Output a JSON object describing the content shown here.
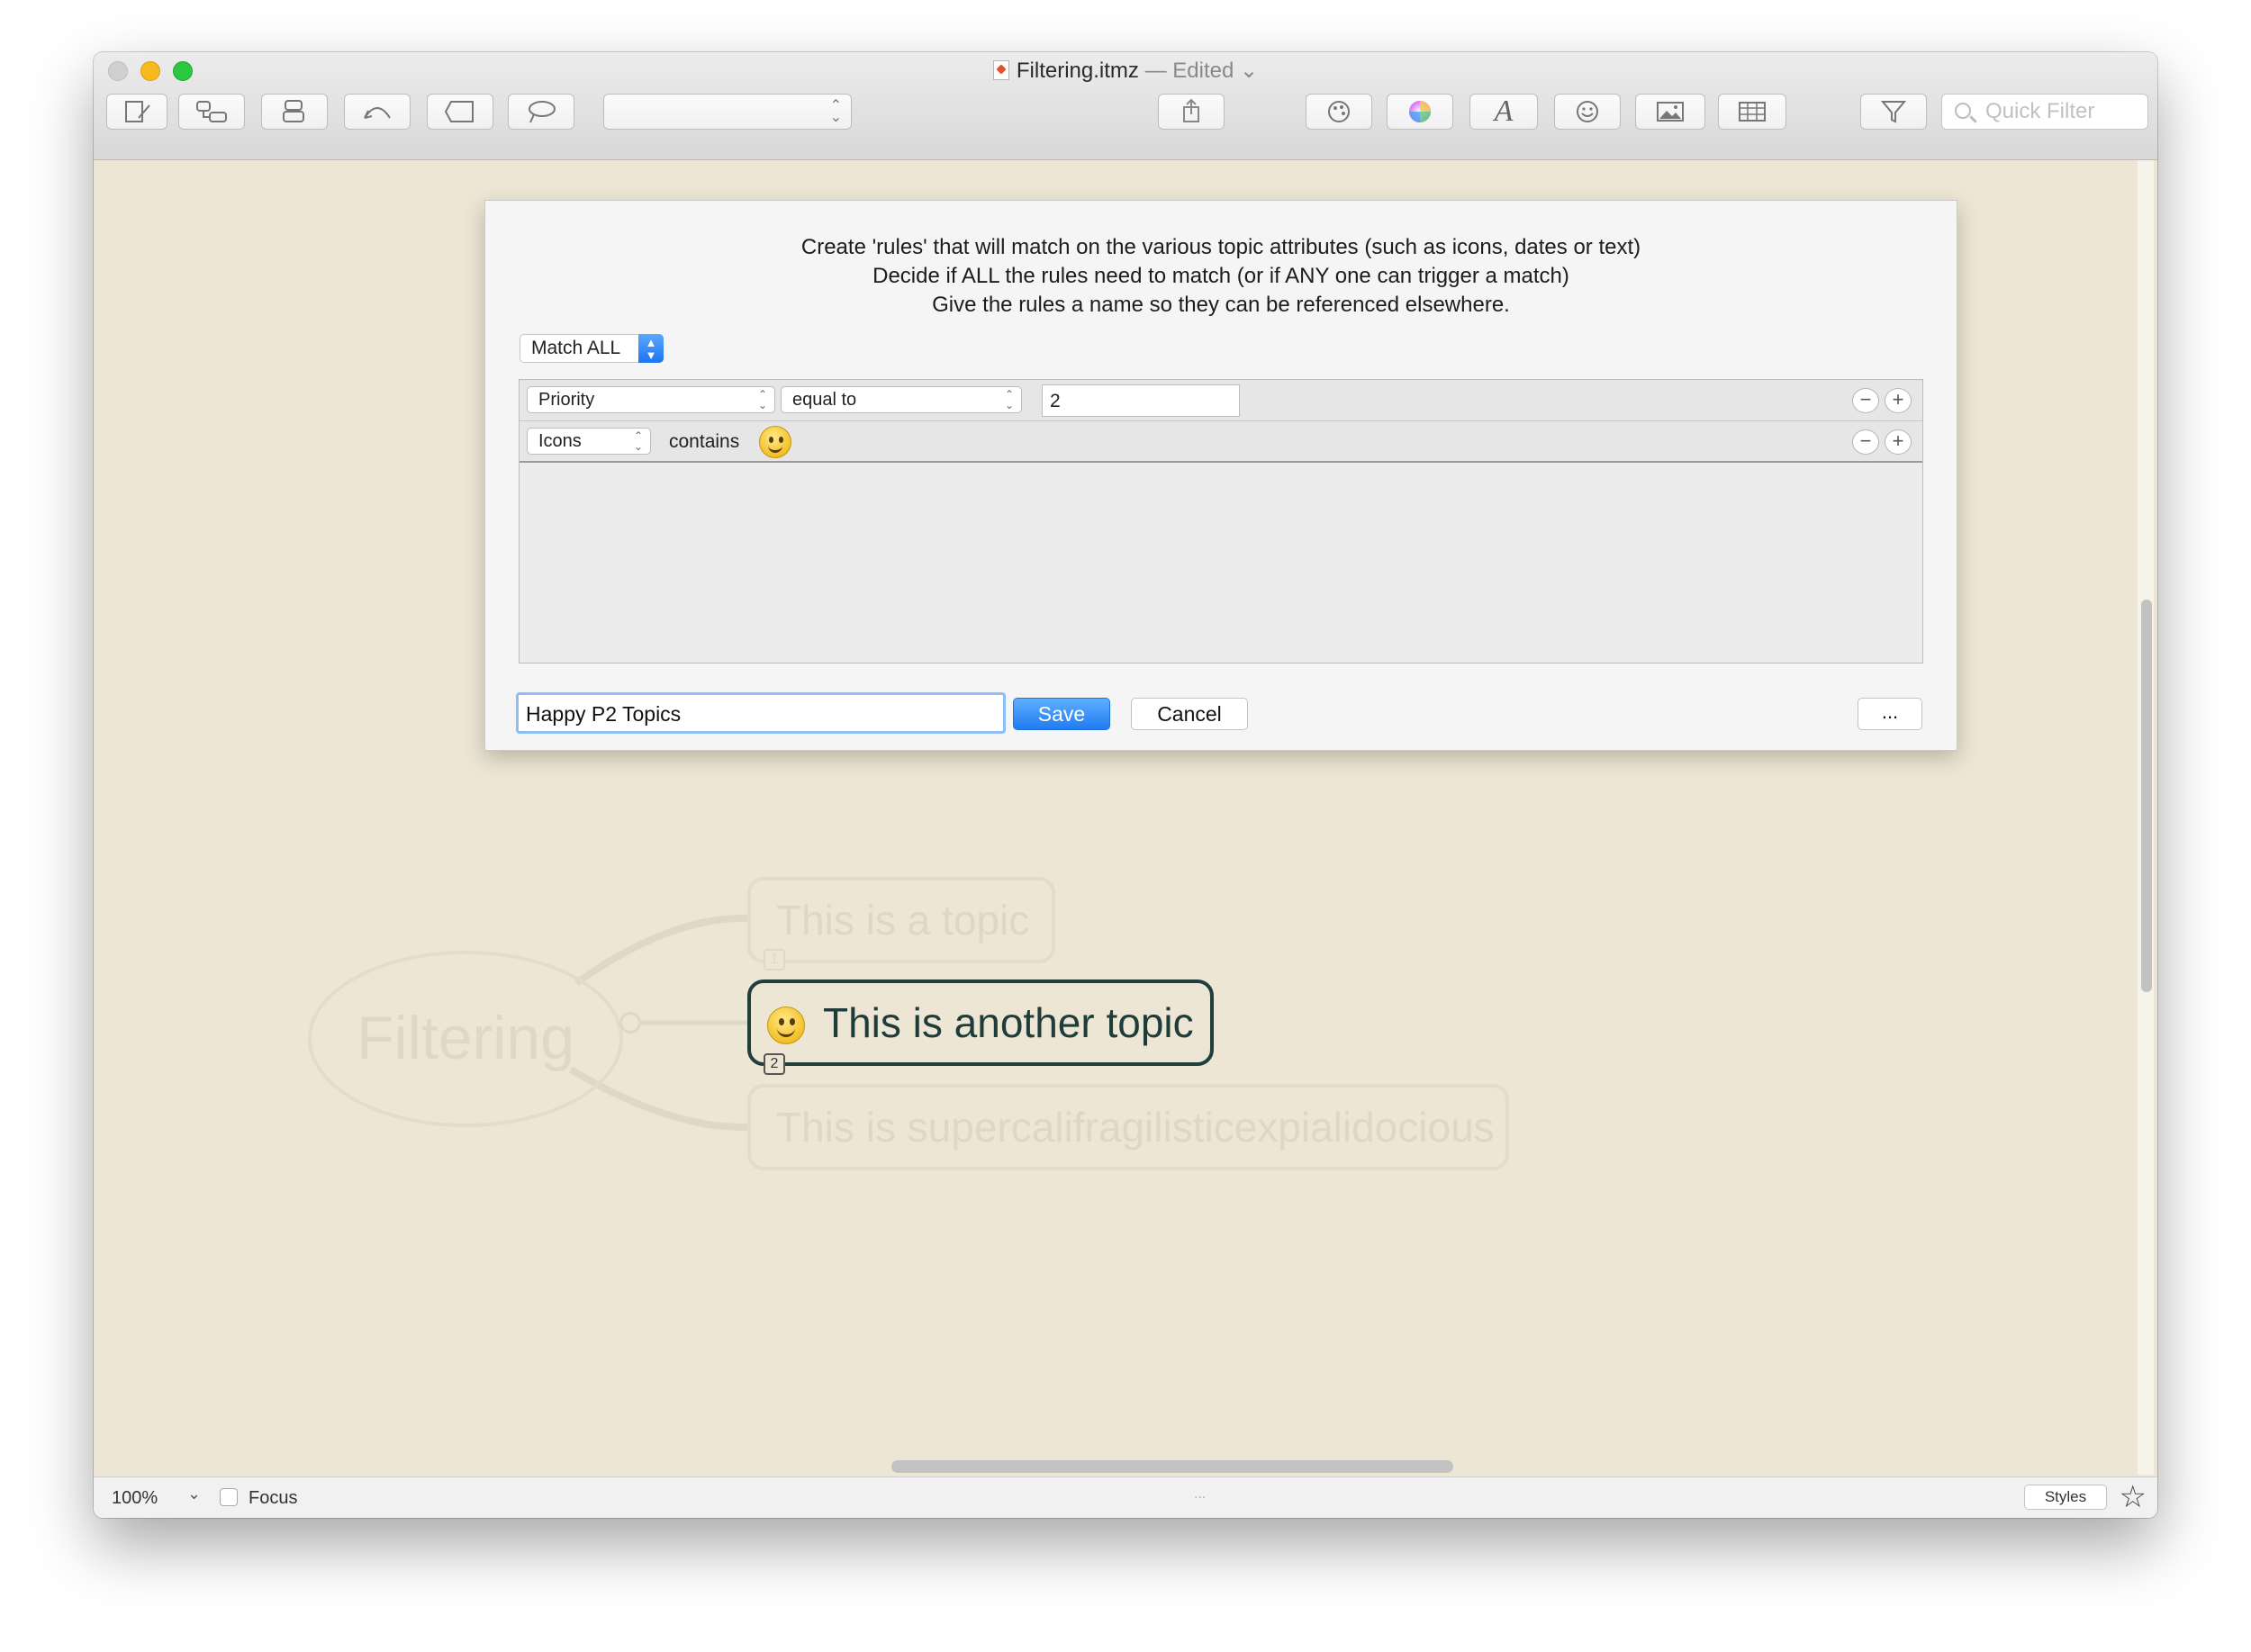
{
  "window": {
    "title": "Filtering.itmz",
    "title_suffix": "— Edited",
    "toolbar_select_value": "",
    "quick_filter_placeholder": "Quick Filter"
  },
  "toolbar_icons": [
    "new-topic-icon",
    "new-child-icon",
    "new-sibling-icon",
    "relationship-icon",
    "boundary-icon",
    "callout-icon",
    "share-icon",
    "styles-palette-icon",
    "color-wheel-icon",
    "font-icon",
    "emoji-icon",
    "image-icon",
    "table-icon",
    "filter-icon"
  ],
  "dialog": {
    "description_lines": [
      "Create 'rules' that will match on the various topic attributes (such as icons, dates or text)",
      "Decide if ALL the rules need to match (or if ANY one can trigger a match)",
      "Give the rules a name so they can be referenced elsewhere."
    ],
    "match_mode": "Match ALL",
    "rules": [
      {
        "attribute": "Priority",
        "operator": "equal to",
        "value": "2"
      },
      {
        "attribute": "Icons",
        "operator": "contains",
        "value_icon": "smiley-icon"
      }
    ],
    "name_value": "Happy P2 Topics",
    "save_label": "Save",
    "cancel_label": "Cancel",
    "more_label": "..."
  },
  "mindmap": {
    "root": "Filtering",
    "topics": [
      {
        "text": "This is a topic",
        "priority": "1",
        "dimmed": true
      },
      {
        "text": "This is another topic",
        "priority": "2",
        "dimmed": false,
        "icon": "smiley-icon"
      },
      {
        "text": "This is supercalifragilisticexpialidocious",
        "dimmed": true
      }
    ]
  },
  "status": {
    "zoom": "100%",
    "focus_label": "Focus",
    "styles_label": "Styles",
    "center_dots": "..."
  }
}
